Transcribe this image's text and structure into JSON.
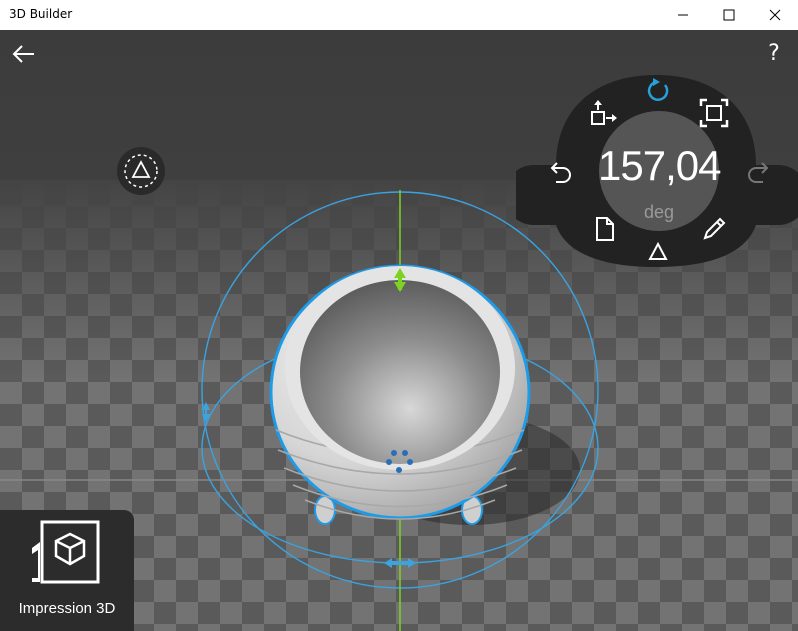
{
  "window": {
    "title": "3D Builder",
    "minimize_icon": "minimize-icon",
    "maximize_icon": "maximize-icon",
    "close_icon": "close-icon"
  },
  "toolbar": {
    "back_icon": "arrow-left-icon",
    "help_label": "?"
  },
  "rotation_panel": {
    "value": "157,04",
    "unit": "deg",
    "accent_color": "#26a0da",
    "active_tool": "rotate",
    "tools": [
      "move",
      "rotate",
      "scale",
      "undo",
      "redo",
      "paste",
      "edit",
      "mode"
    ]
  },
  "app_tile": {
    "label": "Impression 3D"
  },
  "colors": {
    "selection": "#1e9be8",
    "vertical_axis": "#7ed321",
    "panel": "#222222",
    "viewport": "#444444"
  }
}
